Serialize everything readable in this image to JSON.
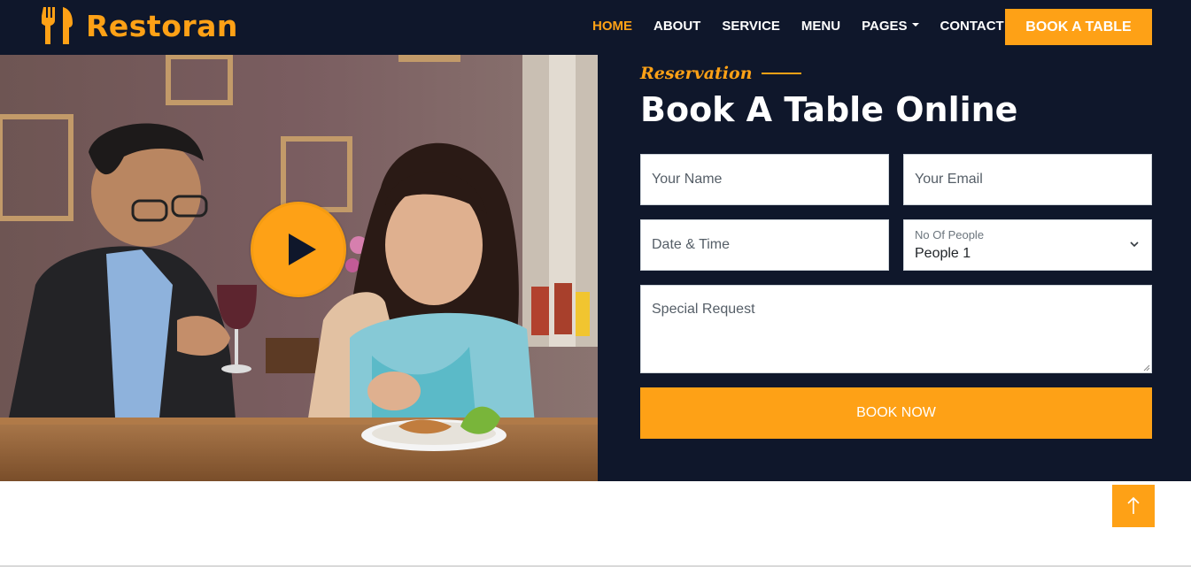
{
  "brand": {
    "name": "Restoran",
    "icon": "utensils-icon"
  },
  "nav": {
    "items": [
      {
        "label": "HOME",
        "active": true
      },
      {
        "label": "ABOUT",
        "active": false
      },
      {
        "label": "SERVICE",
        "active": false
      },
      {
        "label": "MENU",
        "active": false
      },
      {
        "label": "PAGES",
        "active": false,
        "dropdown": true
      },
      {
        "label": "CONTACT",
        "active": false
      }
    ],
    "cta_label": "BOOK A TABLE"
  },
  "hero": {
    "play_icon": "play-icon"
  },
  "reservation": {
    "eyebrow": "Reservation",
    "title": "Book A Table Online",
    "fields": {
      "name_placeholder": "Your Name",
      "email_placeholder": "Your Email",
      "datetime_placeholder": "Date & Time",
      "people_label": "No Of People",
      "people_value": "People 1",
      "request_placeholder": "Special Request"
    },
    "submit_label": "BOOK NOW"
  },
  "back_to_top_icon": "arrow-up-icon",
  "colors": {
    "primary": "#fea116",
    "dark": "#0f172b",
    "white": "#ffffff"
  }
}
